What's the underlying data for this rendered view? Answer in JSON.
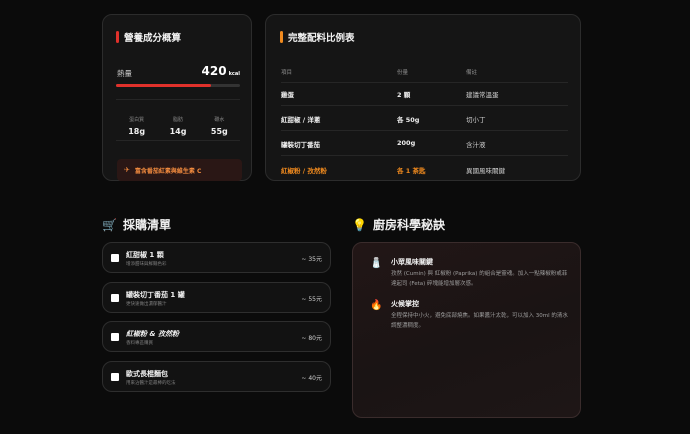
{
  "nutrition": {
    "title": "營養成分概算",
    "accent": "#e0312b",
    "calorie_label": "熱量",
    "calorie_value": "420",
    "calorie_unit": "kcal",
    "calorie_progress_pct": 77,
    "macros": [
      {
        "label": "蛋白質",
        "value": "18g"
      },
      {
        "label": "脂肪",
        "value": "14g"
      },
      {
        "label": "碳水",
        "value": "55g"
      }
    ],
    "badge": "富含番茄紅素與維生素 C"
  },
  "ratio": {
    "title": "完整配料比例表",
    "accent": "#f08a1e",
    "headers": [
      "項目",
      "份量",
      "備註"
    ],
    "rows": [
      {
        "item": "雞蛋",
        "amount": "2 顆",
        "note": "建議常溫蛋"
      },
      {
        "item": "紅甜椒 / 洋蔥",
        "amount": "各 50g",
        "note": "切小丁"
      },
      {
        "item": "罐裝切丁番茄",
        "amount": "200g",
        "note": "含汁液"
      },
      {
        "item": "紅椒粉 / 孜然粉",
        "amount": "各 1 茶匙",
        "note": "異國風味關鍵"
      }
    ]
  },
  "shopping": {
    "heading": "採購清單",
    "items": [
      {
        "name": "紅甜椒 1 顆",
        "desc": "增添甜味與鮮豔色彩",
        "price": "~ 35元"
      },
      {
        "name": "罐裝切丁番茄 1 罐",
        "desc": "更快速做出濃郁醬汁",
        "price": "~ 55元"
      },
      {
        "name": "紅椒粉 & 孜然粉",
        "desc": "香料專區購買",
        "price": "~ 80元"
      },
      {
        "name": "歐式長棍麵包",
        "desc": "用來沾醬汁是最棒的吃法",
        "price": "~ 40元"
      }
    ]
  },
  "tips": {
    "heading": "廚房科學秘訣",
    "items": [
      {
        "title": "小眾風味關鍵",
        "text": "孜然 (Cumin) 與 紅椒粉 (Paprika) 的組合是靈魂。加入一點辣椒粉或菲達起司 (Feta) 碎塊能增加層次感。"
      },
      {
        "title": "火候掌控",
        "text": "全程保持中小火，避免底部燒焦。如果醬汁太乾，可以加入 30ml 的清水調整濃稠度。"
      }
    ]
  }
}
